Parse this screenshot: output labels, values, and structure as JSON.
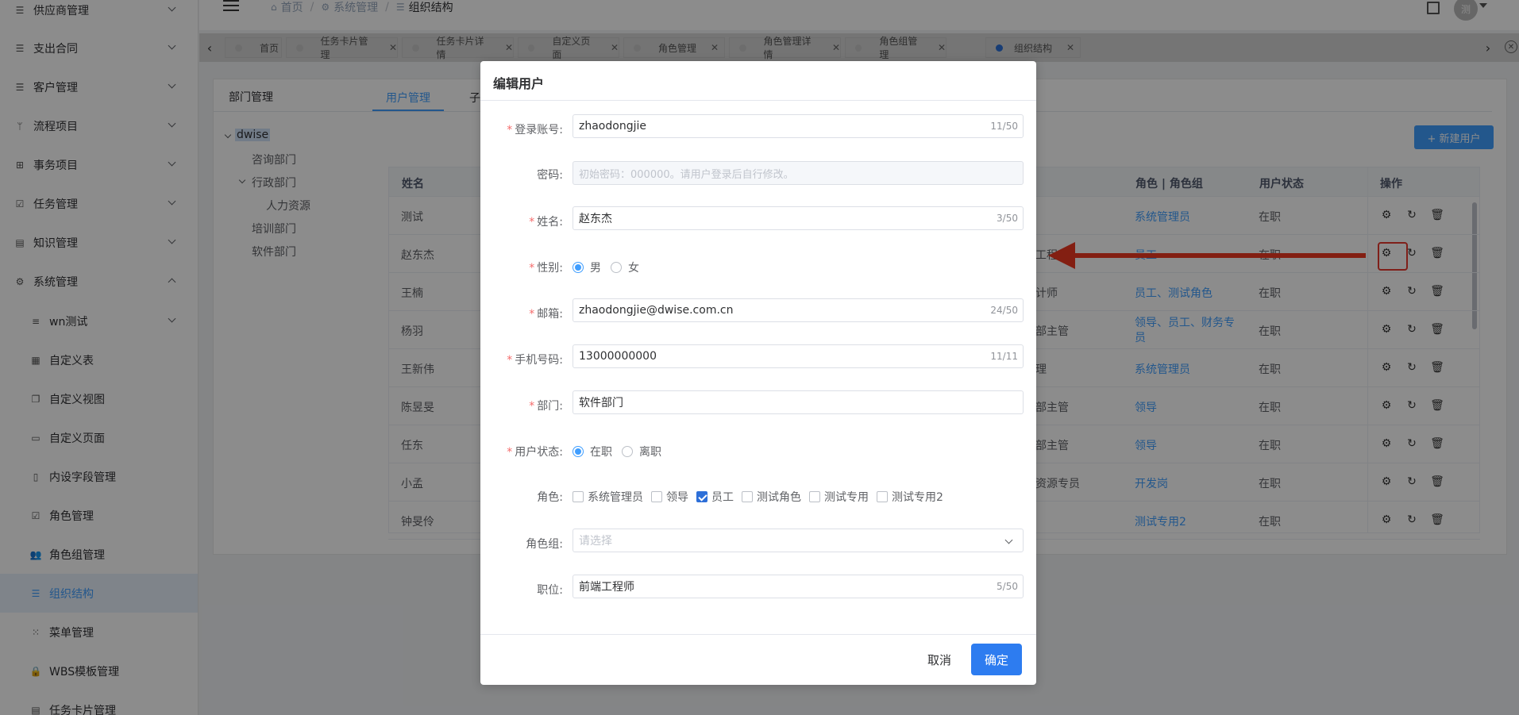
{
  "sidebar": {
    "items": [
      {
        "label": "供应商管理",
        "icon": "list-icon"
      },
      {
        "label": "支出合同",
        "icon": "list-icon"
      },
      {
        "label": "客户管理",
        "icon": "list-icon"
      },
      {
        "label": "流程项目",
        "icon": "branch-icon"
      },
      {
        "label": "事务项目",
        "icon": "grid-icon"
      },
      {
        "label": "任务管理",
        "icon": "calendar-check-icon"
      },
      {
        "label": "知识管理",
        "icon": "book-icon"
      },
      {
        "label": "系统管理",
        "icon": "gear-icon"
      }
    ],
    "sub_items": [
      {
        "label": "wn测试",
        "icon": "filter-icon"
      },
      {
        "label": "自定义表",
        "icon": "doc-icon"
      },
      {
        "label": "自定义视图",
        "icon": "copy-icon"
      },
      {
        "label": "自定义页面",
        "icon": "window-icon"
      },
      {
        "label": "内设字段管理",
        "icon": "field-icon"
      },
      {
        "label": "角色管理",
        "icon": "check-square-icon"
      },
      {
        "label": "角色组管理",
        "icon": "group-icon"
      },
      {
        "label": "组织结构",
        "icon": "list-icon"
      },
      {
        "label": "菜单管理",
        "icon": "grid-dots-icon"
      },
      {
        "label": "WBS模板管理",
        "icon": "lock-icon"
      },
      {
        "label": "任务卡片管理",
        "icon": "card-icon"
      }
    ]
  },
  "breadcrumb": {
    "home": "首页",
    "system": "系统管理",
    "current": "组织结构"
  },
  "header": {
    "avatar_text": "测"
  },
  "tags": [
    {
      "label": "首页"
    },
    {
      "label": "任务卡片管理"
    },
    {
      "label": "任务卡片详情"
    },
    {
      "label": "自定义页面"
    },
    {
      "label": "角色管理"
    },
    {
      "label": "角色管理详情"
    },
    {
      "label": "角色组管理"
    },
    {
      "label": "组织结构"
    }
  ],
  "dept": {
    "tab_label": "部门管理",
    "tree": {
      "root": "dwise",
      "n1": "咨询部门",
      "n2": "行政部门",
      "n2a": "人力资源",
      "n3": "培训部门",
      "n4": "软件部门"
    }
  },
  "user_tabs": {
    "active": "用户管理",
    "other": "子"
  },
  "new_user_button": "+ 新建用户",
  "table": {
    "headers": {
      "name": "姓名",
      "role": "角色 | 角色组",
      "status": "用户状态",
      "ops": "操作"
    },
    "rows": [
      {
        "name": "测试",
        "pos": "",
        "role": "系统管理员",
        "status": "在职"
      },
      {
        "name": "赵东杰",
        "pos": "工程",
        "role": "员工",
        "status": "在职"
      },
      {
        "name": "王楠",
        "pos": "计师",
        "role": "员工、测试角色",
        "status": "在职"
      },
      {
        "name": "杨羽",
        "pos": "部主管",
        "role": "领导、员工、财务专员",
        "status": "在职"
      },
      {
        "name": "王新伟",
        "pos": "理",
        "role": "系统管理员",
        "status": "在职"
      },
      {
        "name": "陈昱旻",
        "pos": "部主管",
        "role": "领导",
        "status": "在职"
      },
      {
        "name": "任东",
        "pos": "部主管",
        "role": "领导",
        "status": "在职"
      },
      {
        "name": "小孟",
        "pos": "资源专员",
        "role": "开发岗",
        "status": "在职"
      },
      {
        "name": "钟旻伶",
        "pos": "",
        "role": "测试专用2",
        "status": "在职"
      }
    ]
  },
  "dialog": {
    "title": "编辑用户",
    "login": {
      "label": "登录账号:",
      "value": "zhaodongjie",
      "count": "11/50"
    },
    "password": {
      "label": "密码:",
      "placeholder": "初始密码：000000。请用户登录后自行修改。"
    },
    "name": {
      "label": "姓名:",
      "value": "赵东杰",
      "count": "3/50"
    },
    "gender": {
      "label": "性别:",
      "options": [
        "男",
        "女"
      ],
      "selected": "男"
    },
    "email": {
      "label": "邮箱:",
      "value": "zhaodongjie@dwise.com.cn",
      "count": "24/50"
    },
    "phone": {
      "label": "手机号码:",
      "value": "13000000000",
      "count": "11/11"
    },
    "dept": {
      "label": "部门:",
      "value": "软件部门"
    },
    "status": {
      "label": "用户状态:",
      "options": [
        "在职",
        "离职"
      ],
      "selected": "在职"
    },
    "roles": {
      "label": "角色:",
      "options": [
        "系统管理员",
        "领导",
        "员工",
        "测试角色",
        "测试专用",
        "测试专用2"
      ],
      "checked": [
        "员工"
      ]
    },
    "role_group": {
      "label": "角色组:",
      "placeholder": "请选择"
    },
    "position": {
      "label": "职位:",
      "value": "前端工程师",
      "count": "5/50"
    },
    "cancel": "取消",
    "ok": "确定"
  },
  "colors": {
    "primary": "#409eff",
    "highlight": "#e83a2f",
    "danger": "#f56c6c"
  }
}
